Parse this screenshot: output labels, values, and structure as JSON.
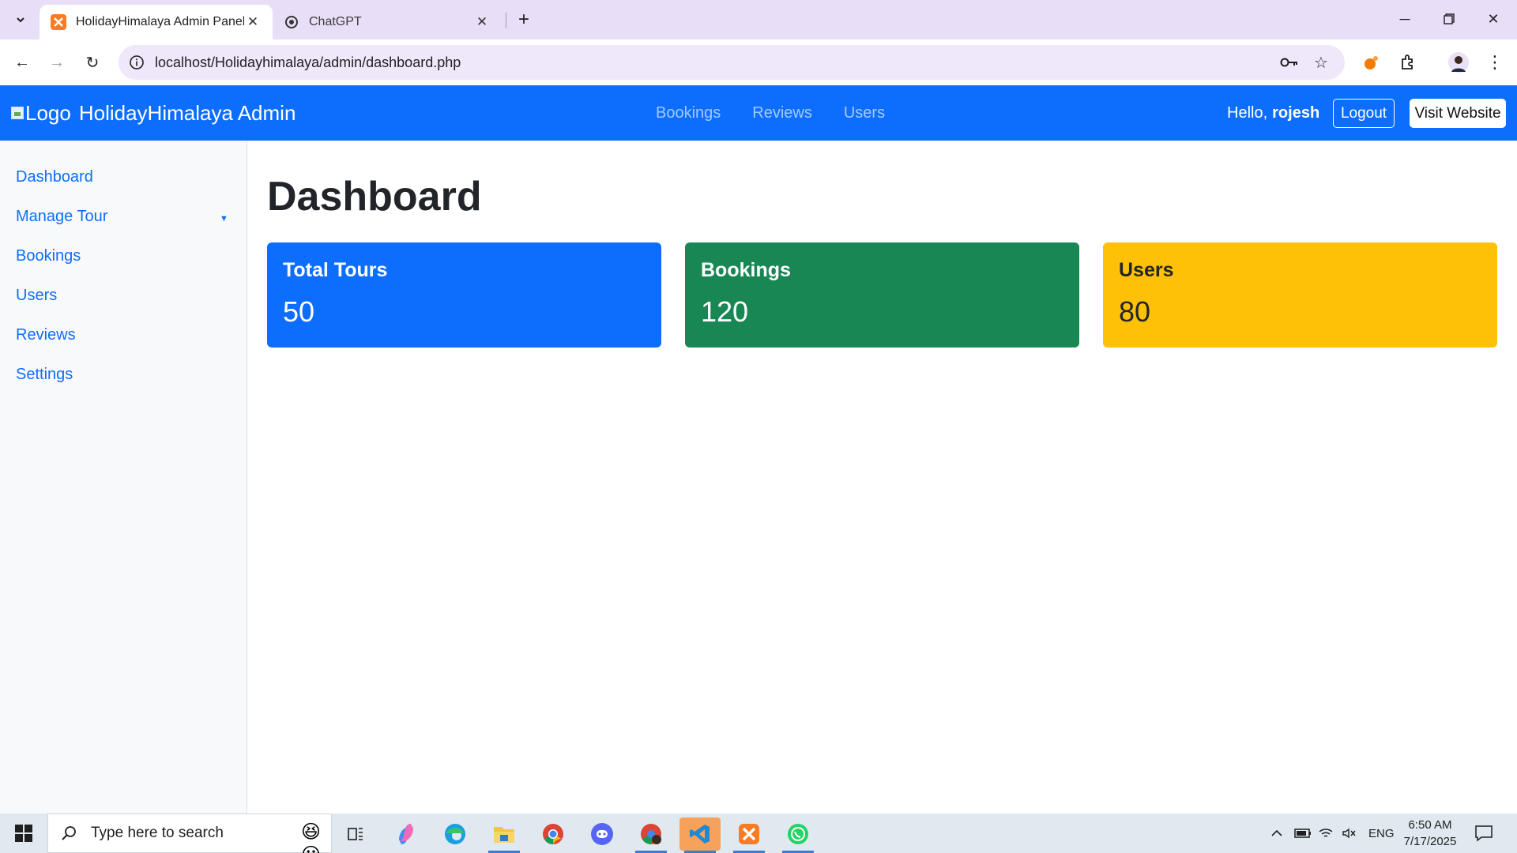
{
  "browser": {
    "tabs": [
      {
        "title": "HolidayHimalaya Admin Panel",
        "active": true
      },
      {
        "title": "ChatGPT",
        "active": false
      }
    ],
    "url": "localhost/Holidayhimalaya/admin/dashboard.php"
  },
  "navbar": {
    "brand_logo_alt": "Logo",
    "brand_name": "HolidayHimalaya Admin",
    "links": [
      "Bookings",
      "Reviews",
      "Users"
    ],
    "greeting": "Hello,",
    "username": "rojesh",
    "logout_label": "Logout",
    "visit_label": "Visit Website"
  },
  "sidebar": {
    "items": [
      "Dashboard",
      "Manage Tour",
      "Bookings",
      "Users",
      "Reviews",
      "Settings"
    ]
  },
  "main": {
    "title": "Dashboard",
    "cards": [
      {
        "label": "Total Tours",
        "value": "50",
        "color": "#0d6efd"
      },
      {
        "label": "Bookings",
        "value": "120",
        "color": "#198754"
      },
      {
        "label": "Users",
        "value": "80",
        "color": "#ffc107"
      }
    ]
  },
  "taskbar": {
    "search_placeholder": "Type here to search",
    "language": "ENG",
    "time": "6:50 AM",
    "date": "7/17/2025",
    "apps": [
      "task-view",
      "copilot",
      "edge",
      "file-explorer",
      "chrome",
      "discord",
      "chrome-profile",
      "vscode",
      "xampp",
      "whatsapp"
    ]
  },
  "colors": {
    "primary": "#0d6efd",
    "success": "#198754",
    "warning": "#ffc107",
    "tabbar": "#e8def8"
  }
}
